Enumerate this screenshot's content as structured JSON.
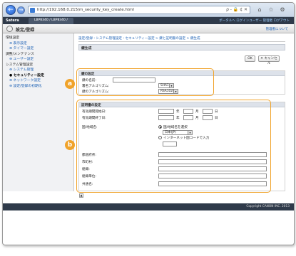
{
  "browser": {
    "url": "http://192.168.0.215/m_security_key_create.html",
    "address_tools": "ρ - 🔒 ¢ ✕",
    "back_glyph": "←",
    "forward_glyph": "→",
    "tab_icons": [
      "⌂",
      "☆",
      "⚙"
    ]
  },
  "header": {
    "brand": "Satera",
    "device_tab": "LBP8340 / LBP8340 /",
    "links": "ポータルへ ログインユーザー 管理者 ログアウト"
  },
  "titlebar": {
    "title": "設定/登録",
    "right_link": "管理者について"
  },
  "sidebar": {
    "items": [
      {
        "label": "環境設定",
        "kind": "group"
      },
      {
        "label": "⊕ 表示設定",
        "kind": "sub"
      },
      {
        "label": "⊕ タイマー設定",
        "kind": "sub"
      },
      {
        "label": "調整/メンテナンス",
        "kind": "group"
      },
      {
        "label": "⊕ ユーザー設定",
        "kind": "sub"
      },
      {
        "label": "システム管理設定",
        "kind": "group"
      },
      {
        "label": "⊕ システム管理",
        "kind": "sub"
      },
      {
        "label": "● セキュリティー設定",
        "kind": "active"
      },
      {
        "label": "⊕ ネットワーク設定",
        "kind": "sub"
      },
      {
        "label": "⊕ 設定/登録の初期化",
        "kind": "sub"
      }
    ]
  },
  "main": {
    "breadcrumb": "設定/登録 : システム管理設定 : セキュリティー設定 > 鍵と証明書の設定 > 鍵生成",
    "page_heading": "鍵生成",
    "ok_label": "OK",
    "cancel_label": "キャンセル"
  },
  "key_settings": {
    "heading": "鍵の設定",
    "key_name_label": "鍵の名前:",
    "sig_alg_label": "署名アルゴリズム:",
    "sig_alg_value": "SHA1",
    "key_alg_label": "鍵のアルゴリズム:",
    "key_alg_value": "RSA1024"
  },
  "cert_settings": {
    "heading": "証明書の設定",
    "start_date_label": "有効期間開始日:",
    "end_date_label": "有効期間終了日:",
    "year_unit": "年",
    "month_unit": "月",
    "day_unit": "日",
    "country_label": "国/地域名:",
    "radio_select": "国/地域名を選択",
    "country_value": "日本(JP)",
    "radio_input": "インターネット国コードで入力",
    "state_label": "都道府県:",
    "city_label": "市町村:",
    "org_label": "組織:",
    "unit_label": "組織単位:",
    "common_name_label": "共通名:"
  },
  "callouts": {
    "a": "a",
    "b": "b"
  },
  "footer": {
    "copyright": "Copyright CANON INC. 2013"
  },
  "colors": {
    "accent": "#f0a32a",
    "header": "#2f3a4a",
    "link": "#1a5fb4"
  }
}
